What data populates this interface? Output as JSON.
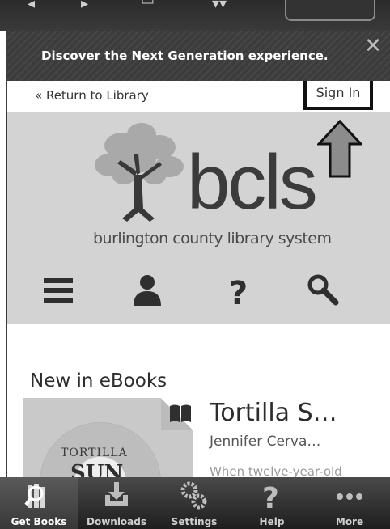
{
  "banner": {
    "link_text": "Discover the Next Generation experience."
  },
  "nav": {
    "return_link": "« Return to Library",
    "sign_in": "Sign In"
  },
  "logo": {
    "wordmark": "bcls",
    "tagline": "burlington county library system"
  },
  "header_icons": [
    "menu-icon",
    "account-icon",
    "help-icon",
    "search-icon"
  ],
  "section": {
    "title": "New in eBooks"
  },
  "book": {
    "cover_line1": "TORTILLA",
    "cover_line2": "SUN",
    "title": "Tortilla S…",
    "author": "Jennifer Cerva…",
    "description": "When twelve-year-old"
  },
  "tabs": [
    {
      "label": "Get Books",
      "icon": "get-books-icon",
      "active": true
    },
    {
      "label": "Downloads",
      "icon": "downloads-icon",
      "active": false
    },
    {
      "label": "Settings",
      "icon": "settings-icon",
      "active": false
    },
    {
      "label": "Help",
      "icon": "help-icon",
      "active": false
    },
    {
      "label": "More",
      "icon": "more-icon",
      "active": false
    }
  ],
  "colors": {
    "header_panel": "#d3d3d3",
    "banner": "#3c3c3c",
    "tabbar": "#2a2a2a"
  }
}
